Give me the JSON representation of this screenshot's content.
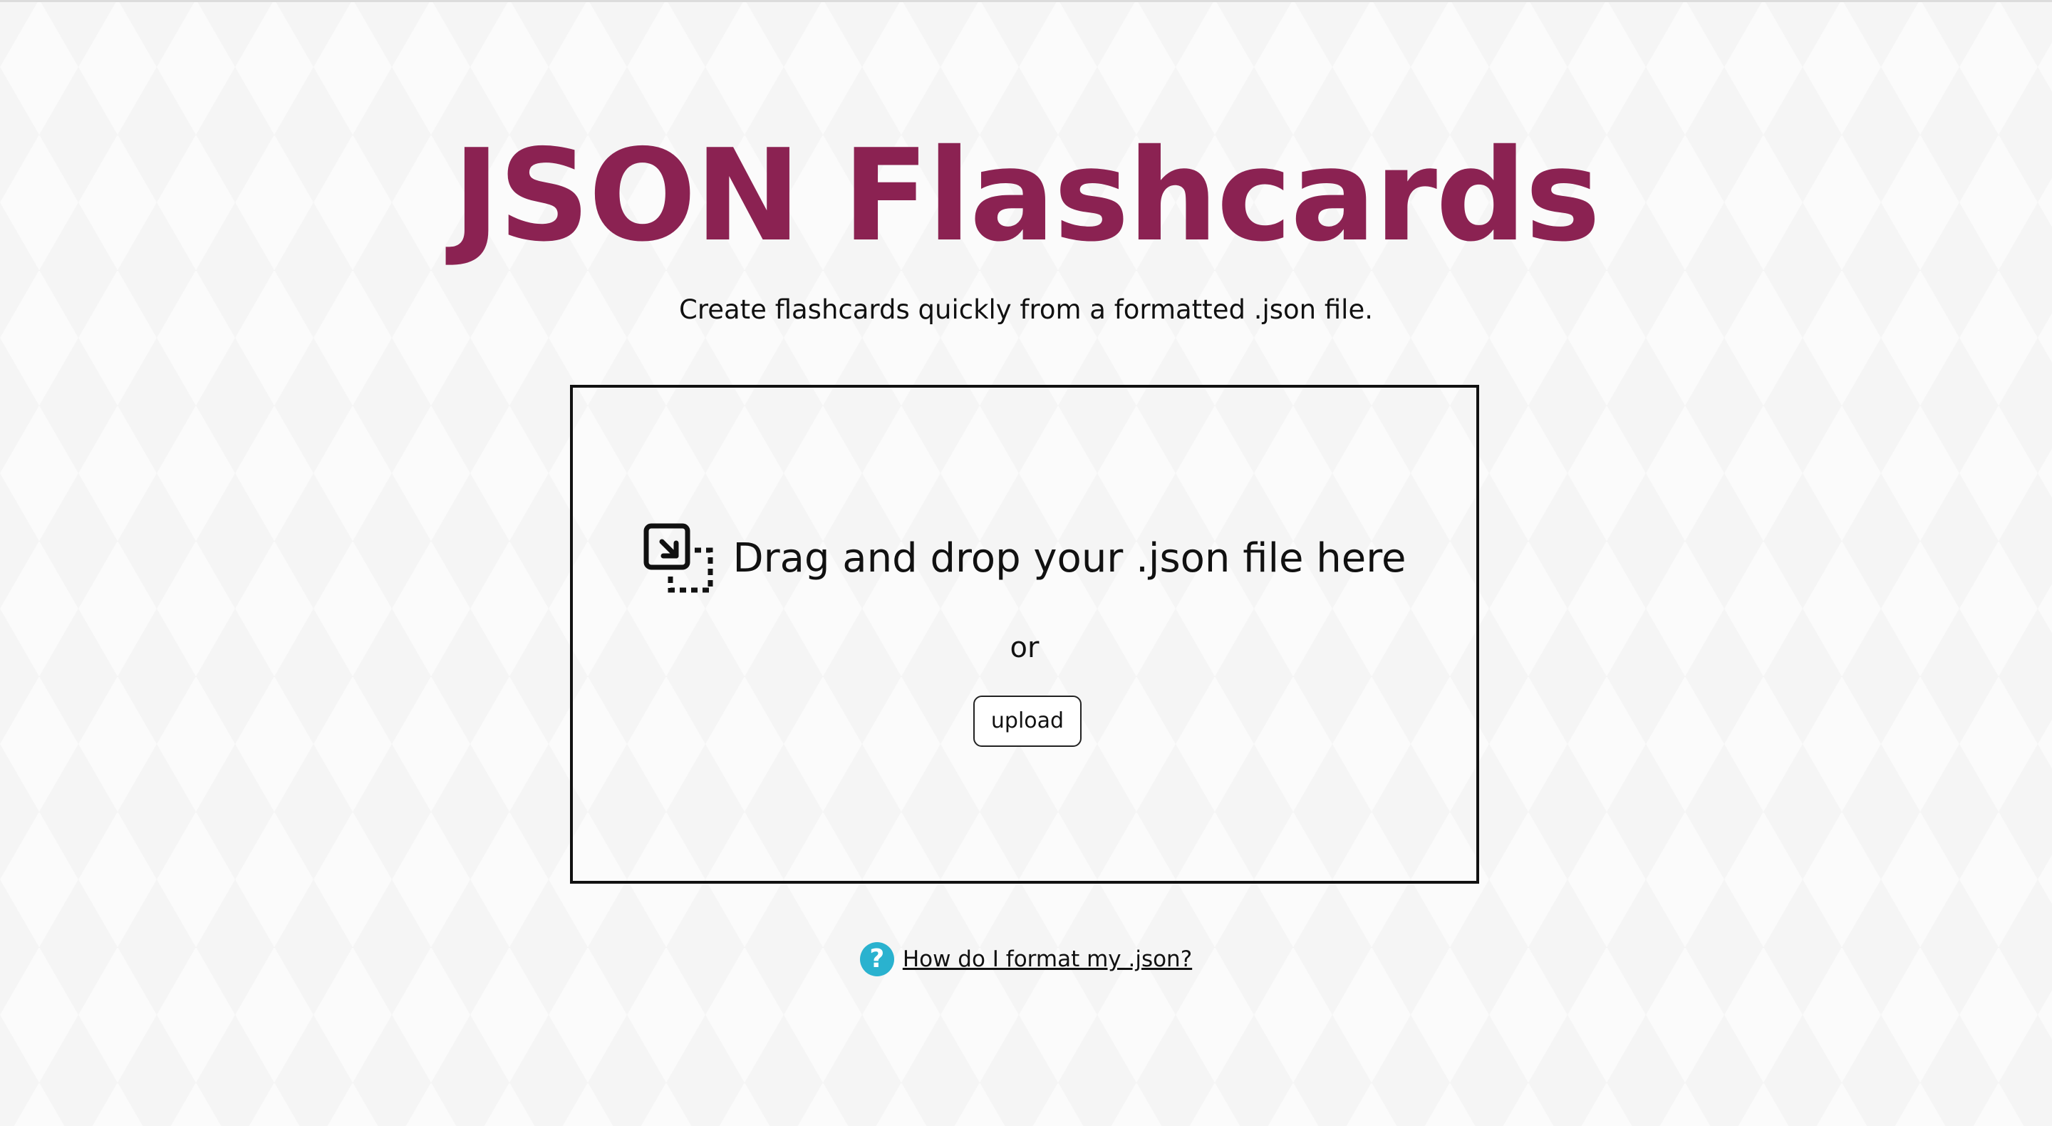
{
  "header": {
    "title": "JSON Flashcards",
    "subtitle": "Create flashcards quickly from a formatted .json file."
  },
  "dropzone": {
    "icon": "drag-drop-icon",
    "drag_text": "Drag and drop your .json file here",
    "or_text": "or",
    "upload_label": "upload"
  },
  "help": {
    "icon": "question-circle-icon",
    "link_text": "How do I format my .json?"
  },
  "colors": {
    "title": "#8b2252",
    "help_icon": "#2ab2cf",
    "background": "#f7f7f7",
    "border": "#111111"
  }
}
